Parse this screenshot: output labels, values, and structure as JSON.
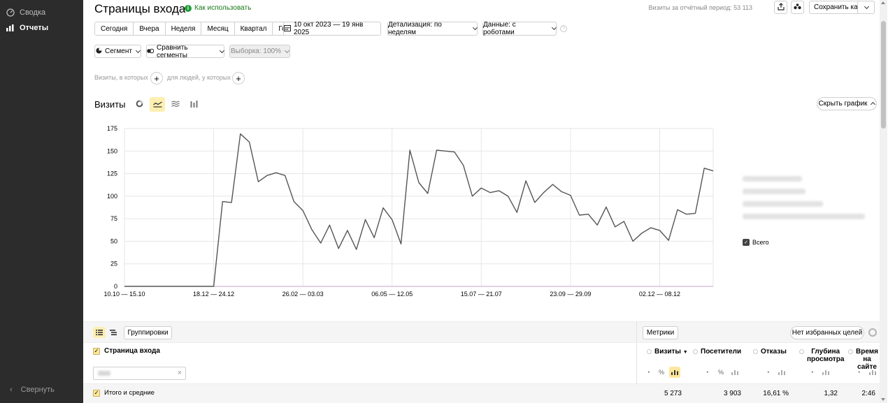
{
  "sidebar": {
    "items": [
      {
        "label": "Сводка",
        "icon": "dashboard-icon"
      },
      {
        "label": "Отчеты",
        "icon": "bar-chart-icon"
      }
    ],
    "collapse_label": "Свернуть"
  },
  "header": {
    "title": "Страницы входа",
    "howto_label": "Как использовать",
    "visits_total": "Визиты за отчётный период: 53 113",
    "save_as_label": "Сохранить как"
  },
  "periods": [
    "Сегодня",
    "Вчера",
    "Неделя",
    "Месяц",
    "Квартал",
    "Год"
  ],
  "date_range": "10 окт 2023 — 19 янв 2025",
  "detail_label": "Детализация: по неделям",
  "data_label": "Данные: с роботами",
  "segment_label": "Сегмент",
  "compare_label": "Сравнить сегменты",
  "sample_label": "Выборка: 100%",
  "conditions": {
    "visits_label": "Визиты, в которых",
    "people_label": "для людей, у которых"
  },
  "chart_section": {
    "title": "Визиты",
    "hide_label": "Скрыть график",
    "legend_total": "Всего"
  },
  "chart_data": {
    "type": "line",
    "title": "",
    "xlabel": "",
    "ylabel": "",
    "ylim": [
      0,
      175
    ],
    "yticks": [
      0,
      25,
      50,
      75,
      100,
      125,
      150,
      175
    ],
    "xtick_labels": [
      "10.10 — 15.10",
      "18.12 — 24.12",
      "26.02 — 03.03",
      "06.05 — 12.05",
      "15.07 — 21.07",
      "23.09 — 29.09",
      "02.12 — 08.12"
    ],
    "xtick_index": [
      0,
      10,
      20,
      30,
      40,
      50,
      60
    ],
    "grid": true,
    "series": [
      {
        "name": "Всего",
        "color": "#555555",
        "values": [
          0,
          0,
          0,
          0,
          0,
          0,
          0,
          0,
          0,
          0,
          0,
          94,
          93,
          169,
          160,
          116,
          123,
          126,
          123,
          94,
          84,
          63,
          48,
          68,
          42,
          62,
          41,
          74,
          54,
          87,
          74,
          47,
          151,
          115,
          103,
          151,
          150,
          149,
          134,
          100,
          109,
          104,
          106,
          100,
          82,
          117,
          93,
          104,
          113,
          105,
          101,
          79,
          80,
          68,
          88,
          66,
          72,
          50,
          59,
          65,
          62,
          51,
          85,
          80,
          81,
          131,
          128
        ]
      }
    ]
  },
  "table": {
    "groupings_label": "Группировки",
    "metrics_label": "Метрики",
    "no_goals_label": "Нет избранных целей",
    "dimension_header": "Страница входа",
    "columns": [
      "Визиты",
      "Посетители",
      "Отказы",
      "Глубина просмотра",
      "Время на сайте"
    ],
    "sort_indicator": "▼",
    "total_label": "Итого и средние",
    "totals": [
      "5 273",
      "3 903",
      "16,61 %",
      "1,32",
      "2:46"
    ]
  }
}
